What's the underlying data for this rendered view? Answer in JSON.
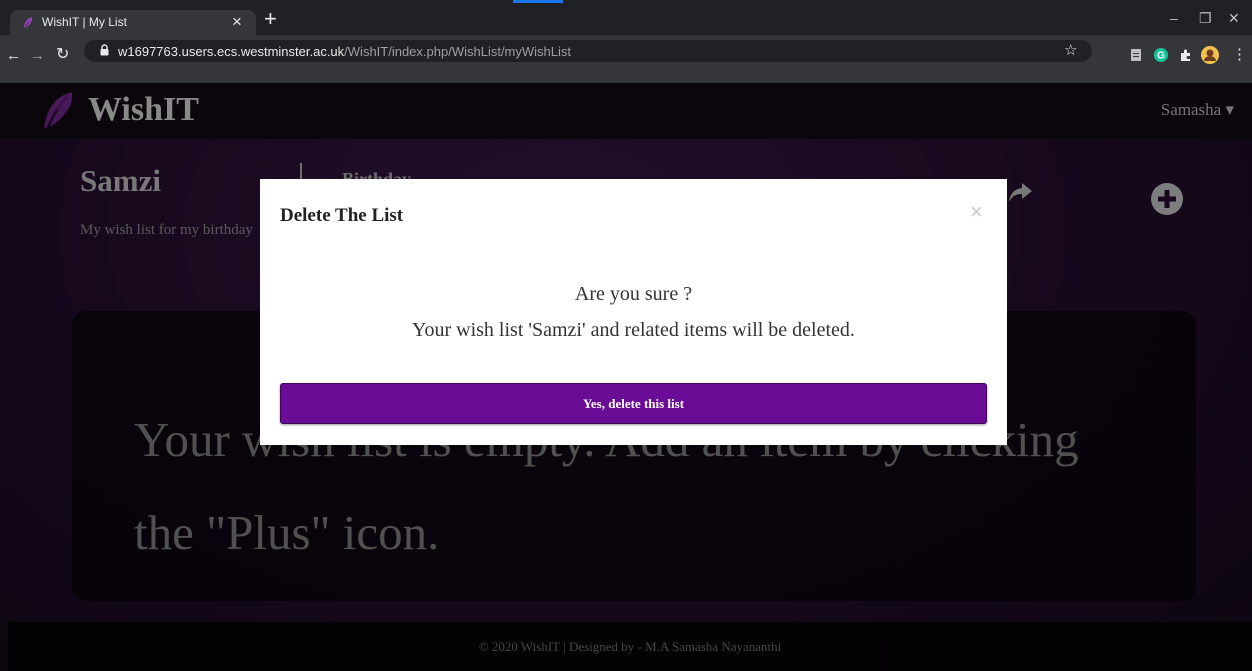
{
  "browser": {
    "tab_title": "WishIT | My List",
    "tab_close": "×",
    "new_tab": "+",
    "url_host": "w1697763.users.ecs.westminster.ac.uk",
    "url_path": "/WishIT/index.php/WishList/myWishList",
    "controls": {
      "minimize": "–",
      "maximize": "❐",
      "close": "✕"
    },
    "nav": {
      "back": "←",
      "forward": "→",
      "reload": "↻"
    },
    "star": "☆",
    "menu": "⋮"
  },
  "site": {
    "brand": "WishIT",
    "user": "Samasha ▾"
  },
  "list": {
    "name": "Samzi",
    "occasion": "Birthday",
    "description": "My wish list for my birthday"
  },
  "empty_state": {
    "text": "Your wish list is empty. Add an item by clicking the \"Plus\" icon.",
    "visible_line1_left": "Your",
    "visible_line1_right": "em",
    "visible_line2": "by clicking the \"Plus\" icon."
  },
  "footer": {
    "text": "© 2020 WishIT | Designed by - M.A Samasha Nayananthi"
  },
  "modal": {
    "title": "Delete The List",
    "close": "×",
    "line1": "Are you sure ?",
    "line2": "Your wish list 'Samzi' and related items will be deleted.",
    "confirm_label": "Yes, delete this list"
  },
  "colors": {
    "accent_purple": "#6a0c95",
    "chrome_dark": "#202124",
    "chrome_toolbar": "#35363a"
  }
}
